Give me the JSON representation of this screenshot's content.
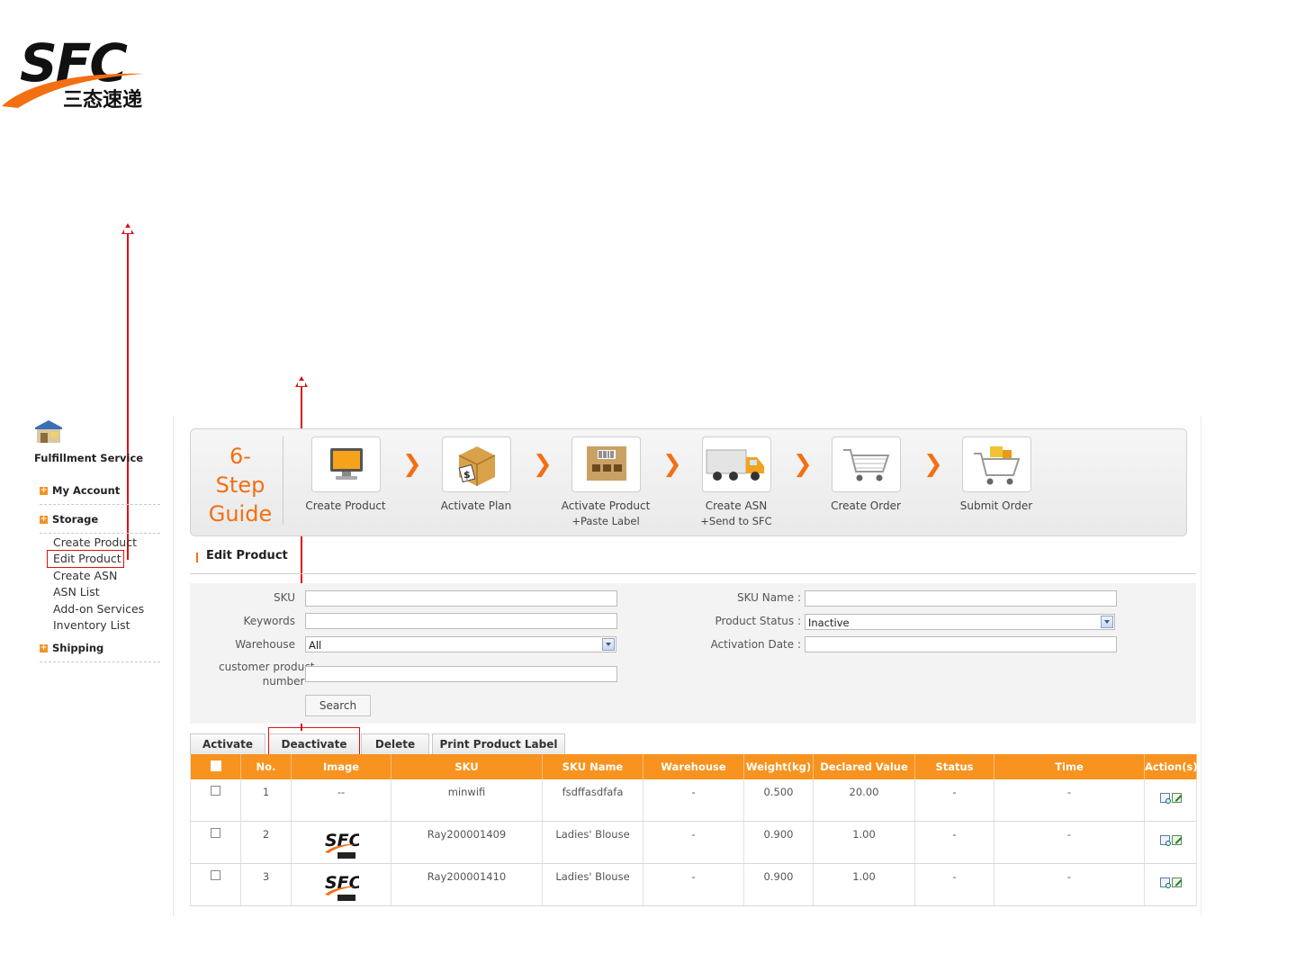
{
  "logo": {
    "brand": "SFC",
    "cn": "三态速递"
  },
  "sidebar": {
    "title": "Fulfillment Service",
    "sections": [
      {
        "label": "My Account"
      },
      {
        "label": "Storage",
        "items": [
          "Create Product",
          "Edit Product",
          "Create ASN",
          "ASN List",
          "Add-on Services",
          "Inventory List"
        ]
      },
      {
        "label": "Shipping"
      }
    ]
  },
  "guide": {
    "title_line1": "6-Step",
    "title_line2": "Guide",
    "steps": [
      {
        "label": "Create Product",
        "sub": "",
        "icon": "monitor-icon"
      },
      {
        "label": "Activate Plan",
        "sub": "",
        "icon": "box-dollar-icon"
      },
      {
        "label": "Activate Product",
        "sub": "+Paste Label",
        "icon": "barcode-box-icon"
      },
      {
        "label": "Create ASN",
        "sub": "+Send to SFC",
        "icon": "truck-icon"
      },
      {
        "label": "Create Order",
        "sub": "",
        "icon": "cart-icon"
      },
      {
        "label": "Submit Order",
        "sub": "",
        "icon": "cart-full-icon"
      }
    ],
    "accent": "#f36f13"
  },
  "section_title": "Edit Product",
  "filter": {
    "sku_label": "SKU",
    "sku_value": "",
    "keywords_label": "Keywords",
    "keywords_value": "",
    "warehouse_label": "Warehouse",
    "warehouse_value": "All",
    "customer_label_1": "customer product",
    "customer_label_2": "number",
    "customer_value": "",
    "sku_name_label": "SKU Name :",
    "sku_name_value": "",
    "status_label": "Product Status :",
    "status_value": "Inactive",
    "activation_label": "Activation Date :",
    "activation_value": "",
    "search_label": "Search"
  },
  "actions": [
    "Activate",
    "Deactivate",
    "Delete",
    "Print Product Label"
  ],
  "table": {
    "headers": [
      "No.",
      "Image",
      "SKU",
      "SKU Name",
      "Warehouse",
      "Weight(kg)",
      "Declared Value",
      "Status",
      "Time",
      "Action(s)"
    ],
    "rows": [
      {
        "no": "1",
        "image": "--",
        "sku": "minwifi",
        "name": "fsdffasdfafa",
        "warehouse": "-",
        "weight": "0.500",
        "value": "20.00",
        "status": "-",
        "time": "-"
      },
      {
        "no": "2",
        "image": "",
        "sku": "Ray200001409",
        "name": "Ladies' Blouse",
        "warehouse": "-",
        "weight": "0.900",
        "value": "1.00",
        "status": "-",
        "time": "-"
      },
      {
        "no": "3",
        "image": "",
        "sku": "Ray200001410",
        "name": "Ladies' Blouse",
        "warehouse": "-",
        "weight": "0.900",
        "value": "1.00",
        "status": "-",
        "time": "-"
      }
    ],
    "header_color": "#f7931e"
  },
  "annotation_color": "#e01010"
}
